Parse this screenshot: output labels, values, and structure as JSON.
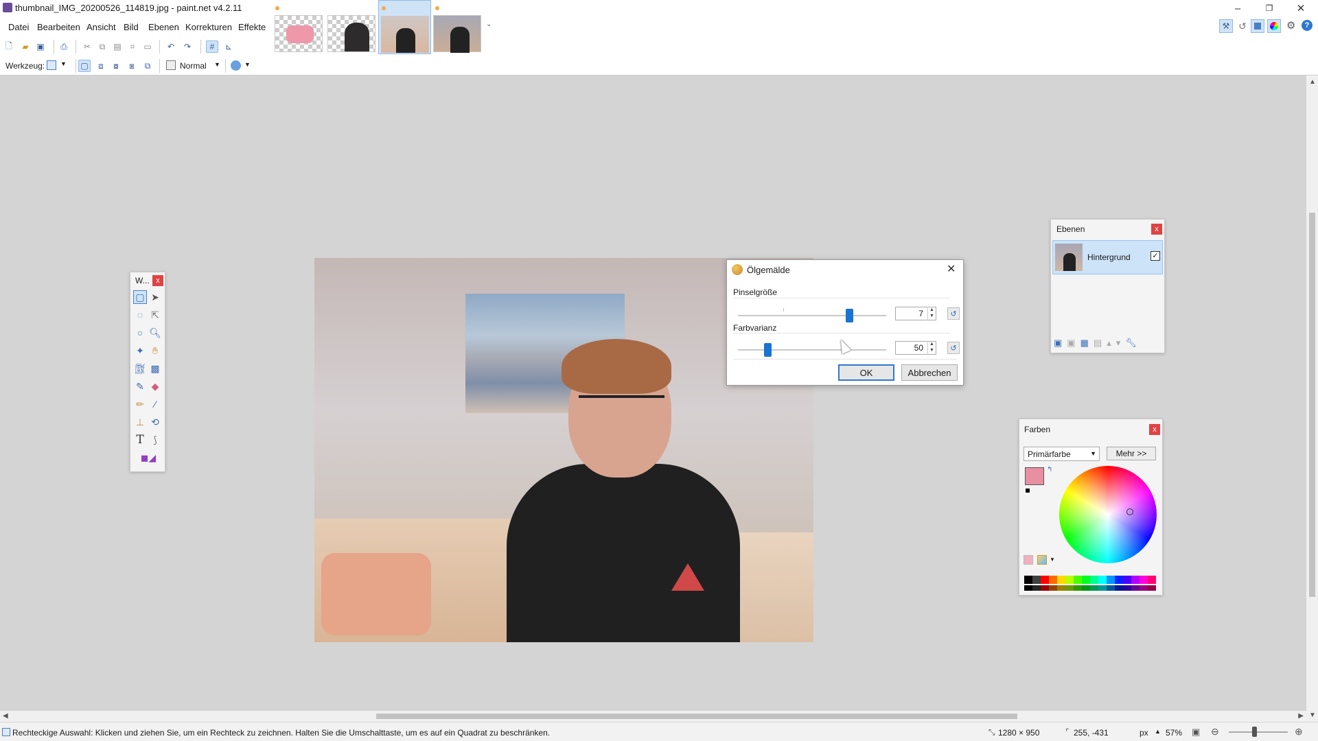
{
  "window": {
    "title": "thumbnail_IMG_20200526_114819.jpg - paint.net v4.2.11",
    "controls": {
      "minimize": "–",
      "maximize": "❐",
      "close": "✕"
    }
  },
  "menu": {
    "items": [
      "Datei",
      "Bearbeiten",
      "Ansicht",
      "Bild",
      "Ebenen",
      "Korrekturen",
      "Effekte"
    ]
  },
  "toolbar": {
    "tool_label": "Werkzeug:",
    "blend_mode": "Normal"
  },
  "tools_window": {
    "title": "W...",
    "tools": [
      "rectangle-select",
      "move-selected",
      "lasso-select",
      "move-selection",
      "ellipse-select",
      "zoom",
      "magic-wand",
      "pan",
      "paint-bucket",
      "gradient",
      "paintbrush",
      "eraser",
      "pencil",
      "color-picker",
      "clone-stamp",
      "recolor",
      "text",
      "line-curve",
      "shapes"
    ]
  },
  "dialog": {
    "title": "Ölgemälde",
    "brush_size_label": "Pinselgröße",
    "brush_size_value": "7",
    "brush_size_fraction": 0.75,
    "color_variance_label": "Farbvarianz",
    "color_variance_value": "50",
    "color_variance_fraction": 0.2,
    "ok": "OK",
    "cancel": "Abbrechen"
  },
  "layers": {
    "title": "Ebenen",
    "layer_name": "Hintergrund"
  },
  "colors": {
    "title": "Farben",
    "mode": "Primärfarbe",
    "more": "Mehr >>",
    "primary": "#e98fa2",
    "secondary": "#ffffff",
    "palette": [
      "#000000",
      "#404040",
      "#ff0000",
      "#ff6a00",
      "#ffd800",
      "#b6ff00",
      "#4cff00",
      "#00ff21",
      "#00ff90",
      "#00ffff",
      "#0094ff",
      "#0026ff",
      "#4800ff",
      "#b200ff",
      "#ff00dc",
      "#ff006e"
    ]
  },
  "status": {
    "hint": "Rechteckige Auswahl: Klicken und ziehen Sie, um ein Rechteck zu zeichnen. Halten Sie die Umschalttaste, um es auf ein Quadrat zu beschränken.",
    "image_size": "1280 × 950",
    "cursor_pos": "255, -431",
    "unit": "px",
    "zoom": "57%"
  }
}
